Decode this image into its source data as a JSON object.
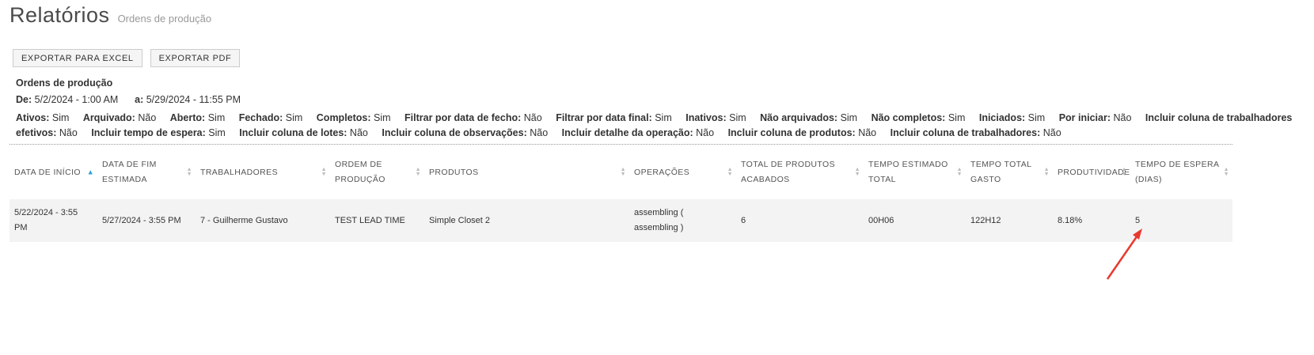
{
  "header": {
    "title": "Relatórios",
    "subtitle": "Ordens de produção"
  },
  "buttons": {
    "export_excel": "EXPORTAR PARA EXCEL",
    "export_pdf": "EXPORTAR PDF"
  },
  "report": {
    "title": "Ordens de produção",
    "from_label": "De:",
    "from_value": "5/2/2024 - 1:00 AM",
    "to_label": "a:",
    "to_value": "5/29/2024 - 11:55 PM"
  },
  "filters": [
    {
      "label": "Ativos:",
      "value": "Sim"
    },
    {
      "label": "Arquivado:",
      "value": "Não"
    },
    {
      "label": "Aberto:",
      "value": "Sim"
    },
    {
      "label": "Fechado:",
      "value": "Sim"
    },
    {
      "label": "Completos:",
      "value": "Sim"
    },
    {
      "label": "Filtrar por data de fecho:",
      "value": "Não"
    },
    {
      "label": "Filtrar por data final:",
      "value": "Sim"
    },
    {
      "label": "Inativos:",
      "value": "Sim"
    },
    {
      "label": "Não arquivados:",
      "value": "Sim"
    },
    {
      "label": "Não completos:",
      "value": "Sim"
    },
    {
      "label": "Iniciados:",
      "value": "Sim"
    },
    {
      "label": "Por iniciar:",
      "value": "Não"
    },
    {
      "label": "Incluir coluna de trabalhadores efetivos:",
      "value": "Não"
    },
    {
      "label": "Incluir tempo de espera:",
      "value": "Sim"
    },
    {
      "label": "Incluir coluna de lotes:",
      "value": "Não"
    },
    {
      "label": "Incluir coluna de observações:",
      "value": "Não"
    },
    {
      "label": "Incluir detalhe da operação:",
      "value": "Não"
    },
    {
      "label": "Incluir coluna de produtos:",
      "value": "Não"
    },
    {
      "label": "Incluir coluna de trabalhadores:",
      "value": "Não"
    }
  ],
  "table": {
    "columns": [
      [
        "DATA DE INÍCIO"
      ],
      [
        "DATA DE FIM",
        "ESTIMADA"
      ],
      [
        "TRABALHADORES"
      ],
      [
        "ORDEM DE",
        "PRODUÇÃO"
      ],
      [
        "PRODUTOS"
      ],
      [
        "OPERAÇÕES"
      ],
      [
        "TOTAL DE PRODUTOS",
        "ACABADOS"
      ],
      [
        "TEMPO ESTIMADO",
        "TOTAL"
      ],
      [
        "TEMPO TOTAL",
        "GASTO"
      ],
      [
        "PRODUTIVIDADE"
      ],
      [
        "TEMPO DE ESPERA",
        "(DIAS)"
      ]
    ],
    "rows": [
      [
        [
          "5/22/2024 - 3:55",
          "PM"
        ],
        [
          "5/27/2024 - 3:55 PM"
        ],
        [
          "7 - Guilherme Gustavo"
        ],
        [
          "TEST LEAD TIME"
        ],
        [
          "Simple Closet 2"
        ],
        [
          "assembling (",
          "assembling )"
        ],
        [
          "6"
        ],
        [
          "00H06"
        ],
        [
          "122H12"
        ],
        [
          "8.18%"
        ],
        [
          "5"
        ]
      ]
    ]
  },
  "colors": {
    "accent": "#2aa3d6",
    "annotation_arrow": "#e8392f",
    "row_bg": "#f3f3f3"
  }
}
